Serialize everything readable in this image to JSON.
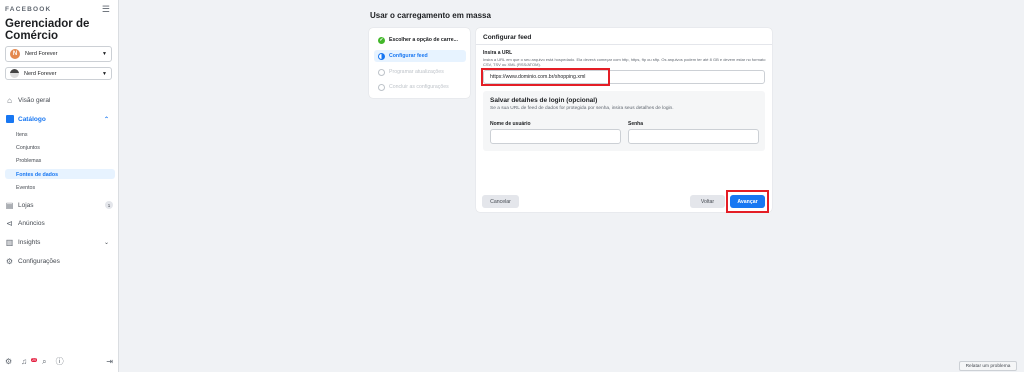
{
  "sidebar": {
    "brand": "FACEBOOK",
    "app_title": "Gerenciador de Comércio",
    "account_select": {
      "initial": "N",
      "label": "Nerd Forever"
    },
    "catalog_select": {
      "label": "Nerd Forever"
    },
    "nav": {
      "overview": "Visão geral",
      "catalog": "Catálogo",
      "catalog_items": [
        "Itens",
        "Conjuntos",
        "Problemas",
        "Fontes de dados",
        "Eventos"
      ],
      "active_sub_item": "Fontes de dados",
      "shops": "Lojas",
      "shops_badge": "1",
      "ads": "Anúncios",
      "insights": "Insights",
      "settings": "Configurações"
    },
    "notification_count": "20"
  },
  "main": {
    "page_title": "Usar o carregamento em massa",
    "steps": [
      {
        "label": "Escolher a opção de carre...",
        "state": "done"
      },
      {
        "label": "Configurar feed",
        "state": "active"
      },
      {
        "label": "Programar atualizações",
        "state": "pending"
      },
      {
        "label": "Concluir as configurações",
        "state": "pending"
      }
    ],
    "form": {
      "title": "Configurar feed",
      "url_label": "Insira a URL",
      "url_help": "Insira a URL em que o seu arquivo está hospedado. Ela deverá começar com http, https, ftp ou sftp. Os arquivos podem ter até 8 GB e devem estar no formato CSV, TSV ou XML (RSS/ATOM).",
      "url_value": "https://www.dominio.com.br/shopping.xml",
      "login_section": {
        "title": "Salvar detalhes de login (opcional)",
        "subtitle": "Se a sua URL de feed de dados for protegida por senha, insira seus detalhes de login.",
        "username_label": "Nome de usuário",
        "password_label": "Senha",
        "username_value": "",
        "password_value": ""
      },
      "cancel_label": "Cancelar",
      "back_label": "Voltar",
      "next_label": "Avançar"
    }
  },
  "footer": {
    "report_label": "Relatar um problema"
  },
  "colors": {
    "accent": "#1877f2",
    "highlight": "#e41e26",
    "success": "#42b72a"
  }
}
